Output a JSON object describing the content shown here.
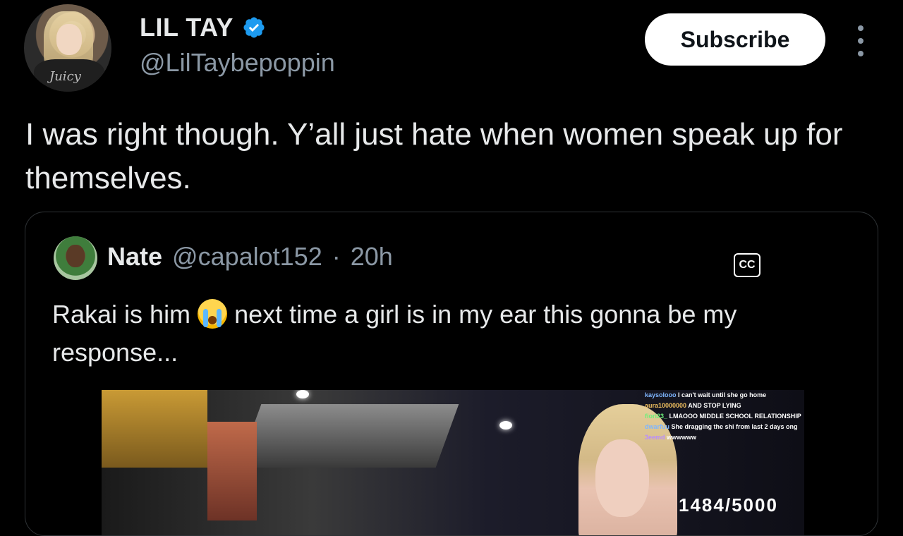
{
  "author": {
    "display_name": "LIL TAY",
    "handle": "@LilTaybepoppin",
    "verified_icon": "verified-badge-icon",
    "avatar_shirt_text": "Juicy"
  },
  "actions": {
    "subscribe_label": "Subscribe",
    "more_icon": "more-vertical-icon"
  },
  "tweet": {
    "text": "I was right though. Y’all just hate when women speak up for themselves."
  },
  "quoted_tweet": {
    "author_name": "Nate",
    "author_handle": "@capalot152",
    "separator": "·",
    "time": "20h",
    "text_before_emoji": "Rakai is him ",
    "emoji": "loudly-crying-face-icon",
    "text_after_emoji": " next time a girl is in my ear this gonna be my response...",
    "video": {
      "chat": [
        {
          "user": "kaysolooo",
          "msg": "I can't wait until she go home"
        },
        {
          "user": "aura10000000",
          "msg": "AND STOP LYING"
        },
        {
          "user": "fiori23_",
          "msg": "LMAOOO MIDDLE SCHOOL RELATIONSHIP"
        },
        {
          "user": "dwarfuu",
          "msg": "She dragging the shi from last 2 days ong"
        },
        {
          "user": "3eemd",
          "msg": "wwwwww"
        }
      ],
      "cc_label": "CC",
      "counter": "1484/5000"
    }
  },
  "colors": {
    "background": "#000000",
    "text": "#e7e9ea",
    "muted": "#8b98a5",
    "verified": "#1d9bf0",
    "border": "#2f3336"
  }
}
